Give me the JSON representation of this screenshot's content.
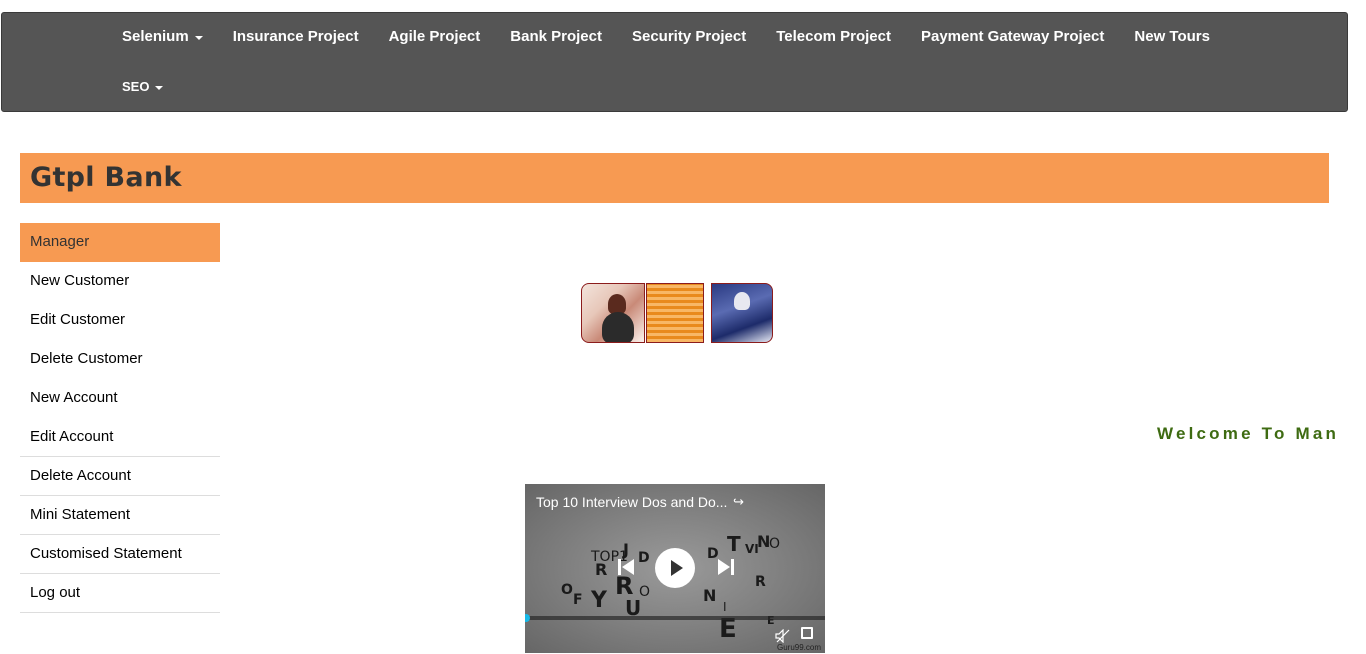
{
  "navbar": {
    "row1": [
      {
        "label": "Selenium",
        "dropdown": true
      },
      {
        "label": "Insurance Project",
        "dropdown": false
      },
      {
        "label": "Agile Project",
        "dropdown": false
      },
      {
        "label": "Bank Project",
        "dropdown": false
      },
      {
        "label": "Security Project",
        "dropdown": false
      },
      {
        "label": "Telecom Project",
        "dropdown": false
      },
      {
        "label": "Payment Gateway Project",
        "dropdown": false
      },
      {
        "label": "New Tours",
        "dropdown": false
      }
    ],
    "row2": [
      {
        "label": "SEO",
        "dropdown": true
      }
    ]
  },
  "banner": {
    "title": "Gtpl Bank",
    "color": "#f79a52"
  },
  "sidebar": {
    "items": [
      {
        "label": "Manager",
        "active": true
      },
      {
        "label": "New Customer"
      },
      {
        "label": "Edit Customer"
      },
      {
        "label": "Delete Customer"
      },
      {
        "label": "New Account"
      },
      {
        "label": "Edit Account"
      },
      {
        "label": "Delete Account"
      },
      {
        "label": "Mini Statement"
      },
      {
        "label": "Customised Statement"
      },
      {
        "label": "Log out"
      }
    ]
  },
  "welcome": {
    "text": "Welcome To Man",
    "color": "#3e6b12"
  },
  "video": {
    "title": "Top 10 Interview Dos and Do...",
    "watermark": "Guru99.com",
    "progress": 0.0
  }
}
